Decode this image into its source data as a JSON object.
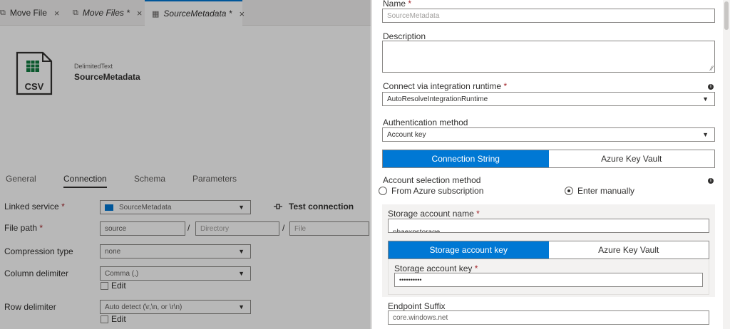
{
  "tabs": [
    {
      "label": "Move File",
      "icon": "pipeline-icon",
      "close": "×"
    },
    {
      "label": "Move Files *",
      "icon": "pipeline-icon",
      "close": "×"
    },
    {
      "label": "SourceMetadata *",
      "icon": "table-icon",
      "close": "×"
    }
  ],
  "dataset": {
    "type": "DelimitedText",
    "name": "SourceMetadata",
    "icon_text": "CSV"
  },
  "property_tabs": [
    "General",
    "Connection",
    "Schema",
    "Parameters"
  ],
  "connection": {
    "linked_service": {
      "label": "Linked service",
      "value": "SourceMetadata"
    },
    "test_connection": "Test connection",
    "file_path": {
      "label": "File path",
      "container": "source",
      "directory": "Directory",
      "file": "File"
    },
    "compression": {
      "label": "Compression type",
      "value": "none"
    },
    "column_delimiter": {
      "label": "Column delimiter",
      "value": "Comma (,)",
      "edit": "Edit"
    },
    "row_delimiter": {
      "label": "Row delimiter",
      "value": "Auto detect (\\r,\\n, or \\r\\n)",
      "edit": "Edit"
    },
    "required_mark": "*"
  },
  "panel": {
    "name": {
      "label": "Name",
      "value": "SourceMetadata"
    },
    "description": {
      "label": "Description",
      "value": ""
    },
    "runtime": {
      "label": "Connect via integration runtime",
      "value": "AutoResolveIntegrationRuntime"
    },
    "auth": {
      "label": "Authentication method",
      "value": "Account key"
    },
    "conn_toggle": {
      "option_a": "Connection String",
      "option_b": "Azure Key Vault"
    },
    "account_selection": {
      "label": "Account selection method",
      "option_a": "From Azure subscription",
      "option_b": "Enter manually"
    },
    "storage_name": {
      "label": "Storage account name",
      "value": "nbaexpstorage"
    },
    "key_toggle": {
      "option_a": "Storage account key",
      "option_b": "Azure Key Vault"
    },
    "storage_key": {
      "label": "Storage account key",
      "value": "••••••••••"
    },
    "endpoint": {
      "label": "Endpoint Suffix",
      "value": "core.windows.net"
    },
    "required_mark": "*"
  },
  "colors": {
    "accent": "#0078d4",
    "required": "#a4262c"
  }
}
